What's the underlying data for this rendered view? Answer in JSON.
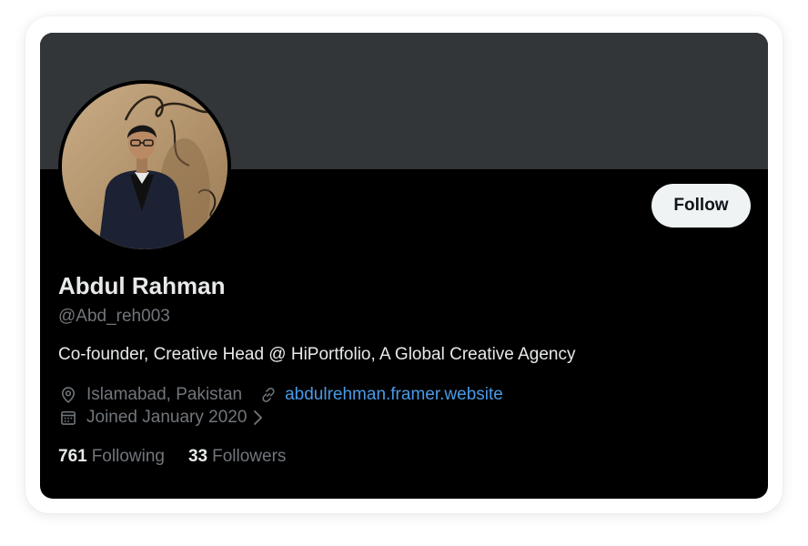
{
  "profile": {
    "display_name": "Abdul Rahman",
    "handle": "@Abd_reh003",
    "bio": "Co-founder, Creative Head @ HiPortfolio, A Global Creative Agency",
    "location": "Islamabad, Pakistan",
    "website": "abdulrehman.framer.website",
    "joined": "Joined January 2020",
    "following_count": "761",
    "following_label": "Following",
    "followers_count": "33",
    "followers_label": "Followers"
  },
  "actions": {
    "follow_label": "Follow"
  },
  "icons": {
    "location": "map-pin-icon",
    "website": "link-icon",
    "joined": "calendar-icon",
    "joined_expand": "chevron-right-icon"
  },
  "colors": {
    "banner": "#333639",
    "card_background": "#000000",
    "primary_text": "#e7e9ea",
    "secondary_text": "#71767b",
    "link": "#4a9ae6",
    "follow_button_bg": "#eff3f4"
  }
}
